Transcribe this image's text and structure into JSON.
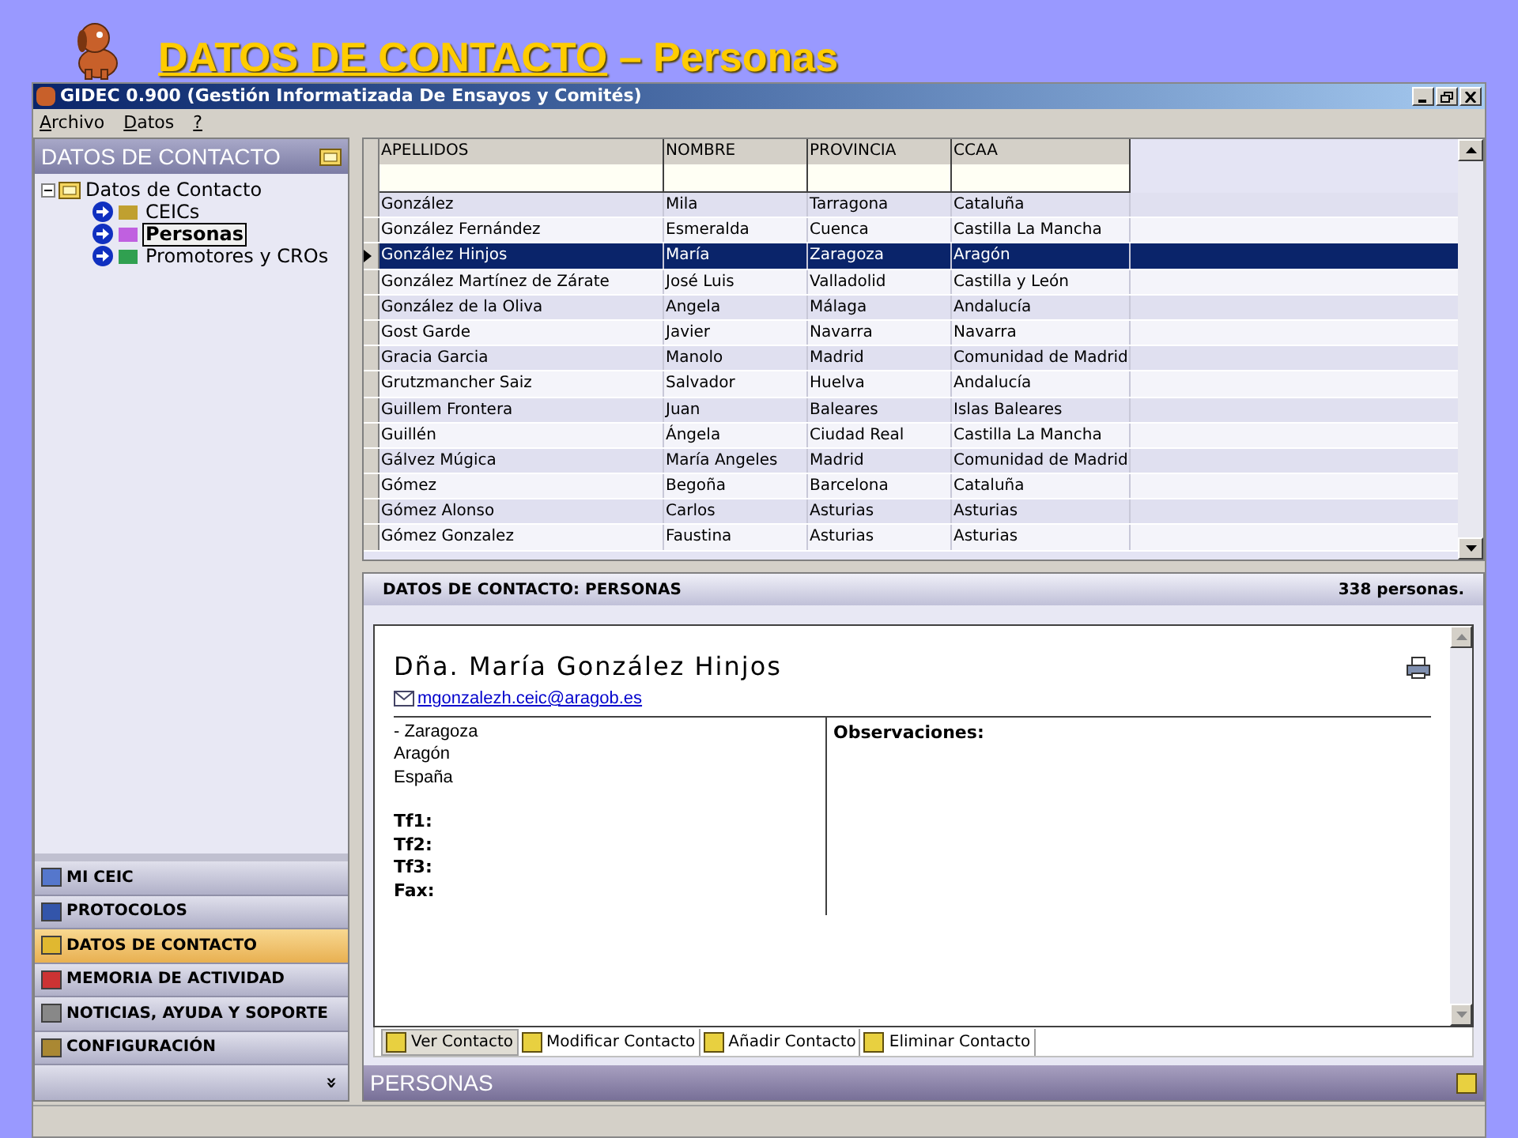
{
  "slide_title": {
    "main": "DATOS DE CONTACTO",
    "rest": "– Personas"
  },
  "window": {
    "title": "GIDEC 0.900 (Gestión Informatizada De Ensayos y Comités)"
  },
  "menu": [
    "Archivo",
    "Datos",
    "?"
  ],
  "sidebar": {
    "title": "DATOS DE CONTACTO",
    "tree": [
      {
        "label": "Datos de Contacto",
        "expanded": true,
        "selected": false,
        "children": [
          {
            "label": "CEICs",
            "selected": false
          },
          {
            "label": "Personas",
            "selected": true
          },
          {
            "label": "Promotores y CROs",
            "selected": false
          }
        ]
      }
    ],
    "nav": [
      {
        "label": "MI CEIC",
        "selected": false
      },
      {
        "label": "PROTOCOLOS",
        "selected": false
      },
      {
        "label": "DATOS DE CONTACTO",
        "selected": true
      },
      {
        "label": "MEMORIA DE ACTIVIDAD",
        "selected": false
      },
      {
        "label": "NOTICIAS, AYUDA Y SOPORTE",
        "selected": false
      },
      {
        "label": "CONFIGURACIÓN",
        "selected": false
      }
    ],
    "more": "»"
  },
  "table": {
    "columns": [
      "APELLIDOS",
      "NOMBRE",
      "PROVINCIA",
      "CCAA"
    ],
    "rows": [
      {
        "cells": [
          "González",
          "Mila",
          "Tarragona",
          "Cataluña"
        ],
        "selected": false
      },
      {
        "cells": [
          "González Fernández",
          "Esmeralda",
          "Cuenca",
          "Castilla La Mancha"
        ],
        "selected": false
      },
      {
        "cells": [
          "González Hinjos",
          "María",
          "Zaragoza",
          "Aragón"
        ],
        "selected": true
      },
      {
        "cells": [
          "González Martínez de Zárate",
          "José Luis",
          "Valladolid",
          "Castilla y León"
        ],
        "selected": false
      },
      {
        "cells": [
          "González de la Oliva",
          "Angela",
          "Málaga",
          "Andalucía"
        ],
        "selected": false
      },
      {
        "cells": [
          "Gost Garde",
          "Javier",
          "Navarra",
          "Navarra"
        ],
        "selected": false
      },
      {
        "cells": [
          "Gracia Garcia",
          "Manolo",
          "Madrid",
          "Comunidad de Madrid"
        ],
        "selected": false
      },
      {
        "cells": [
          "Grutzmancher Saiz",
          "Salvador",
          "Huelva",
          "Andalucía"
        ],
        "selected": false
      },
      {
        "cells": [
          "Guillem Frontera",
          "Juan",
          "Baleares",
          "Islas Baleares"
        ],
        "selected": false
      },
      {
        "cells": [
          "Guillén",
          "Ángela",
          "Ciudad Real",
          "Castilla La Mancha"
        ],
        "selected": false
      },
      {
        "cells": [
          "Gálvez Múgica",
          "María Angeles",
          "Madrid",
          "Comunidad de Madrid"
        ],
        "selected": false
      },
      {
        "cells": [
          "Gómez",
          "Begoña",
          "Barcelona",
          "Cataluña"
        ],
        "selected": false
      },
      {
        "cells": [
          "Gómez Alonso",
          "Carlos",
          "Asturias",
          "Asturias"
        ],
        "selected": false
      },
      {
        "cells": [
          "Gómez Gonzalez",
          "Faustina",
          "Asturias",
          "Asturias"
        ],
        "selected": false
      }
    ]
  },
  "detail": {
    "header": "DATOS DE CONTACTO: PERSONAS",
    "count": "338 personas.",
    "name": "Dña. María González Hinjos",
    "email": "mgonzalezh.ceic@aragob.es",
    "address": [
      "- Zaragoza",
      "Aragón",
      "España"
    ],
    "phones": [
      "Tf1:",
      "Tf2:",
      "Tf3:",
      "Fax:"
    ],
    "observations": "Observaciones:",
    "tabs": [
      {
        "label": "Ver Contacto",
        "selected": true
      },
      {
        "label": "Modificar Contacto",
        "selected": false
      },
      {
        "label": "Añadir Contacto",
        "selected": false
      },
      {
        "label": "Eliminar Contacto",
        "selected": false
      }
    ],
    "footer": "PERSONAS"
  }
}
